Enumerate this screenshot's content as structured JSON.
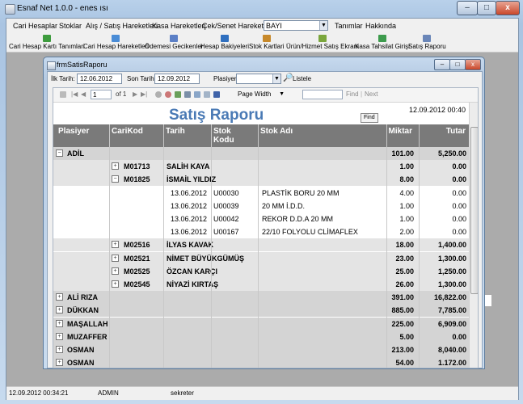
{
  "window": {
    "title": "Esnaf Net 1.0.0 - enes ısı",
    "controls": [
      "–",
      "□",
      "x"
    ]
  },
  "menu": {
    "items": [
      "Cari Hesaplar",
      "Stoklar",
      "Alış / Satış Hareketleri",
      "Kasa Hareketleri",
      "Çek/Senet Hareketleri",
      "Tanımlar",
      "Hakkında"
    ],
    "user_combo": "BAYI"
  },
  "toolbar": {
    "items": [
      {
        "label": "Cari Hesap Kartı Tanımlari",
        "icon": "card-icon",
        "color": "#3e9c3e"
      },
      {
        "label": "Cari Hesap Hareketleri",
        "icon": "ledger-icon",
        "color": "#4a8cd6"
      },
      {
        "label": "Ödemesi Gecikenler",
        "icon": "clock-icon",
        "color": "#5b7fc6"
      },
      {
        "label": "Hesap Bakiyeleri",
        "icon": "balance-icon",
        "color": "#2f6fbf"
      },
      {
        "label": "Stok Kartlari",
        "icon": "stock-icon",
        "color": "#c7892b"
      },
      {
        "label": "Ürün/Hizmet Satış Ekranı",
        "icon": "sale-icon",
        "color": "#7aa63c"
      },
      {
        "label": "Kasa Tahsilat Girişi",
        "icon": "cash-icon",
        "color": "#3d9b4d"
      },
      {
        "label": "Satış Raporu",
        "icon": "report-icon",
        "color": "#6a86b8"
      }
    ]
  },
  "status": {
    "datetime": "12.09.2012 00:34:21",
    "user": "ADMIN",
    "role": "sekreter"
  },
  "child": {
    "title": "frmSatisRaporu",
    "filters": {
      "start_label": "İlk Tarih:",
      "start_value": "12.06.2012",
      "end_label": "Son Tarih:",
      "end_value": "12.09.2012",
      "seller_label": "Plasiyer:",
      "seller_value": "",
      "list_button": "Listele"
    },
    "report_toolbar": {
      "page": "1",
      "of_pages": "of 1",
      "zoom": "Page Width",
      "find": "Find",
      "next": "Next",
      "find_tooltip": "Find"
    },
    "report": {
      "title": "Satış Raporu",
      "printed": "12.09.2012 00:40",
      "columns": [
        "Plasiyer",
        "CariKod",
        "Tarih",
        "Stok Kodu",
        "Stok Adı",
        "Miktar",
        "Tutar"
      ],
      "rows": [
        {
          "kind": "group",
          "expander": "−",
          "plasiyer": "ADİL",
          "miktar": "101.00",
          "tutar": "5,250.00"
        },
        {
          "kind": "sub",
          "expander": "+",
          "carikod": "M01713",
          "tarih": "SALİH KAYA",
          "miktar": "1.00",
          "tutar": "0.00"
        },
        {
          "kind": "sub",
          "expander": "−",
          "carikod": "M01825",
          "tarih": "İSMAİL YILDIZ",
          "miktar": "8.00",
          "tutar": "0.00"
        },
        {
          "kind": "det",
          "tarih": "13.06.2012",
          "stokkod": "U00030",
          "stokadi": "PLASTİK BORU 20 MM",
          "miktar": "4.00",
          "tutar": "0.00"
        },
        {
          "kind": "det",
          "tarih": "13.06.2012",
          "stokkod": "U00039",
          "stokadi": "20 MM İ.D.D.",
          "miktar": "1.00",
          "tutar": "0.00"
        },
        {
          "kind": "det",
          "tarih": "13.06.2012",
          "stokkod": "U00042",
          "stokadi": "REKOR D.D.A 20 MM",
          "miktar": "1.00",
          "tutar": "0.00"
        },
        {
          "kind": "det",
          "tarih": "13.06.2012",
          "stokkod": "U00167",
          "stokadi": "22/10 FOLYOLU CLİMAFLEX",
          "miktar": "2.00",
          "tutar": "0.00"
        },
        {
          "kind": "sub",
          "expander": "+",
          "carikod": "M02516",
          "tarih": "İLYAS KAVAK",
          "miktar": "18.00",
          "tutar": "1,400.00"
        },
        {
          "kind": "sub",
          "expander": "+",
          "carikod": "M02521",
          "tarih": "NİMET BÜYÜKGÜMÜŞ",
          "miktar": "23.00",
          "tutar": "1,300.00"
        },
        {
          "kind": "sub",
          "expander": "+",
          "carikod": "M02525",
          "tarih": "ÖZCAN KARÇI",
          "miktar": "25.00",
          "tutar": "1,250.00"
        },
        {
          "kind": "sub",
          "expander": "+",
          "carikod": "M02545",
          "tarih": "NİYAZİ KIRTAŞ",
          "miktar": "26.00",
          "tutar": "1,300.00"
        },
        {
          "kind": "group",
          "expander": "+",
          "plasiyer": "ALİ RIZA",
          "miktar": "391.00",
          "tutar": "16,822.00"
        },
        {
          "kind": "group",
          "expander": "+",
          "plasiyer": "DÜKKAN",
          "miktar": "885.00",
          "tutar": "7,785.00"
        },
        {
          "kind": "group",
          "expander": "+",
          "plasiyer": "MAŞALLAH",
          "miktar": "225.00",
          "tutar": "6,909.00"
        },
        {
          "kind": "group",
          "expander": "+",
          "plasiyer": "MUZAFFER",
          "miktar": "5.00",
          "tutar": "0.00"
        },
        {
          "kind": "group",
          "expander": "+",
          "plasiyer": "OSMAN",
          "miktar": "213.00",
          "tutar": "8,040.00"
        },
        {
          "kind": "group",
          "expander": "+",
          "plasiyer": "OSMAN",
          "miktar": "54.00",
          "tutar": "1.172.00"
        }
      ]
    }
  }
}
